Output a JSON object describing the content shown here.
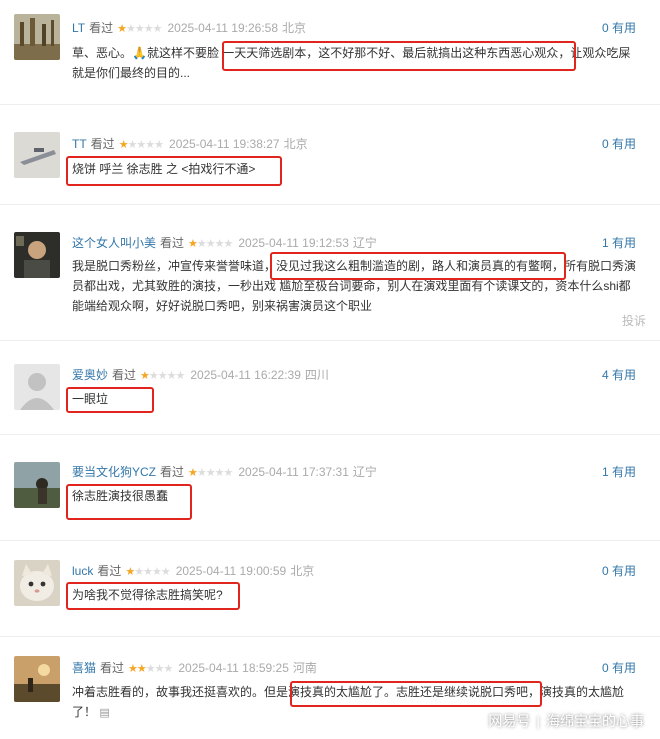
{
  "comments": [
    {
      "user": "LT",
      "watched": "看过",
      "stars": 1,
      "time": "2025-04-11 19:26:58",
      "location": "北京",
      "useful_count": "0",
      "useful_label": "有用",
      "text_line1": "草、恶心。🙏就这样不要脸",
      "text_highlight": "一天天筛选剧本，这不好那不好、最后就搞出这种东西恶心观众",
      "text_after": "，让观众吃屎就是你们最终的目的..."
    },
    {
      "user": "TT",
      "watched": "看过",
      "stars": 1,
      "time": "2025-04-11 19:38:27",
      "location": "北京",
      "useful_count": "0",
      "useful_label": "有用",
      "text_highlight": "烧饼 呼兰 徐志胜 之 <拍戏行不通>"
    },
    {
      "user": "这个女人叫小美",
      "watched": "看过",
      "stars": 1,
      "time": "2025-04-11 19:12:53",
      "location": "辽宁",
      "useful_count": "1",
      "useful_label": "有用",
      "text_before": "我是脱口秀粉丝，冲宣传来誉誉味道，",
      "text_highlight": "没见过我这么粗制滥造的剧，路人和演员真的有鳖啊",
      "text_after": "，所有脱口秀演员都出戏，尤其致胜的演技，一秒出戏 尴尬至极台词要命，别人在演戏里面有个读课文的，资本什么shi都能端给观众啊，好好说脱口秀吧，别来祸害演员这个职业",
      "report": "投诉"
    },
    {
      "user": "爱奥妙",
      "watched": "看过",
      "stars": 1,
      "time": "2025-04-11 16:22:39",
      "location": "四川",
      "useful_count": "4",
      "useful_label": "有用",
      "text_highlight": "一眼垃"
    },
    {
      "user": "要当文化狗YCZ",
      "watched": "看过",
      "stars": 1,
      "time": "2025-04-11 17:37:31",
      "location": "辽宁",
      "useful_count": "1",
      "useful_label": "有用",
      "text_highlight": "徐志胜演技很愚蠢"
    },
    {
      "user": "luck",
      "watched": "看过",
      "stars": 1,
      "time": "2025-04-11 19:00:59",
      "location": "北京",
      "useful_count": "0",
      "useful_label": "有用",
      "text_highlight": "为啥我不觉得徐志胜搞笑呢?"
    },
    {
      "user": "喜猫",
      "watched": "看过",
      "stars": 2,
      "time": "2025-04-11 18:59:25",
      "location": "河南",
      "useful_count": "0",
      "useful_label": "有用",
      "text_before": "冲着志胜看的，故事我还挺喜欢的。但是",
      "text_highlight": "演技真的太尴尬了。志胜还是继续说脱口秀吧",
      "text_after": "，演技真的太尴尬了！"
    }
  ],
  "watermark": {
    "source": "网易号",
    "author": "海绵宝宝的心事"
  },
  "colors": {
    "username": "#3377aa",
    "star_on": "#f5a623",
    "star_off": "#dcdcdc",
    "highlight_box": "#e0241e",
    "meta_gray": "#aaaaaa"
  }
}
